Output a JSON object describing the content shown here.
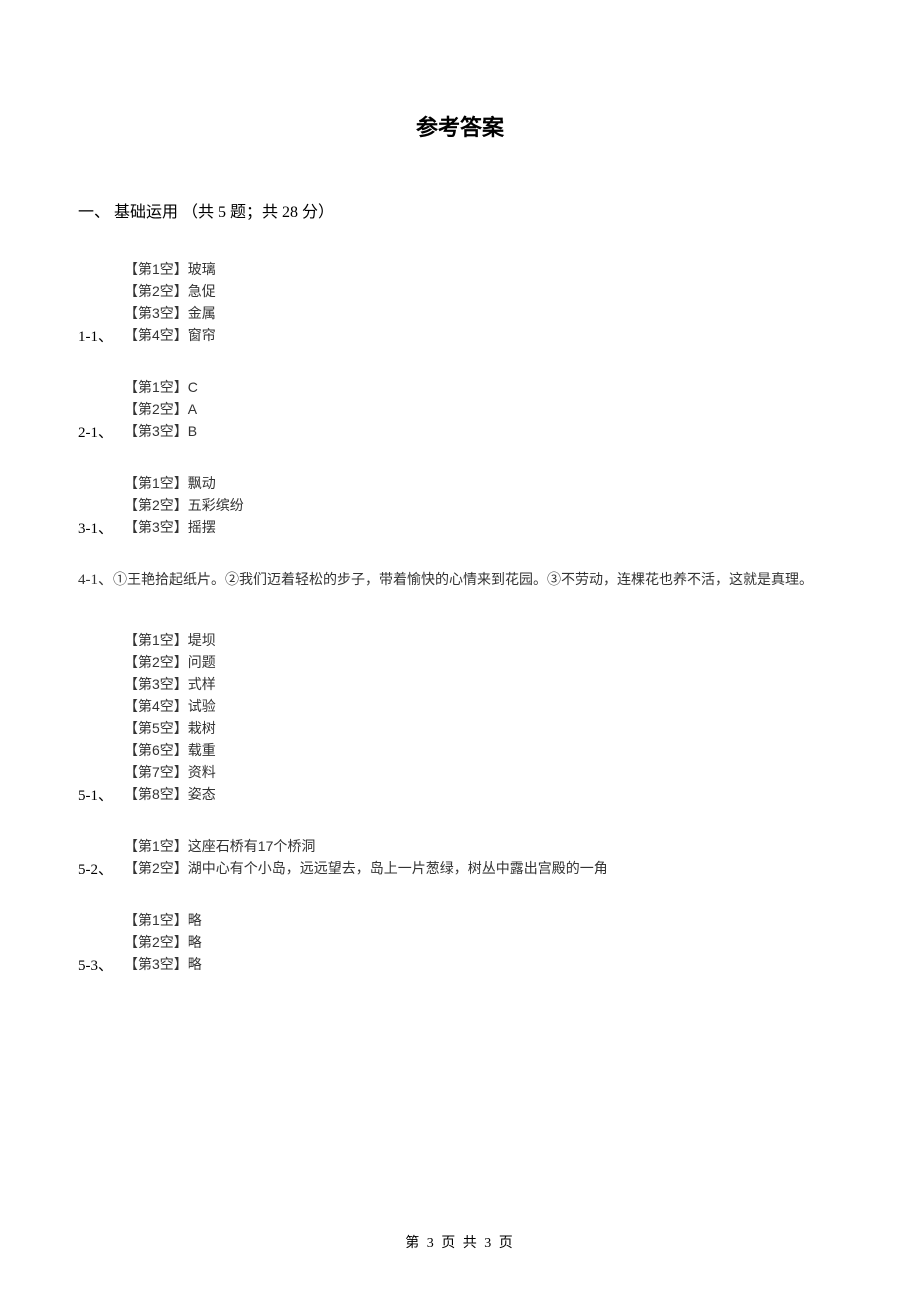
{
  "title": "参考答案",
  "section": "一、 基础运用 （共 5 题；共 28 分）",
  "q1": {
    "num": "1-1、",
    "lines": [
      "【第1空】玻璃",
      "【第2空】急促",
      "【第3空】金属",
      "【第4空】窗帘"
    ]
  },
  "q2": {
    "num": "2-1、",
    "lines": [
      "【第1空】C",
      "【第2空】A",
      "【第3空】B"
    ]
  },
  "q3": {
    "num": "3-1、",
    "lines": [
      "【第1空】飘动",
      "【第2空】五彩缤纷",
      "【第3空】摇摆"
    ]
  },
  "q4": {
    "num": "4-1、",
    "text": "①王艳拾起纸片。②我们迈着轻松的步子，带着愉快的心情来到花园。③不劳动，连棵花也养不活，这就是真理。"
  },
  "q5": {
    "num": "5-1、",
    "lines": [
      "【第1空】堤坝",
      "【第2空】问题",
      "【第3空】式样",
      "【第4空】试验",
      "【第5空】栽树",
      "【第6空】载重",
      "【第7空】资料",
      "【第8空】姿态"
    ]
  },
  "q6": {
    "num": "5-2、",
    "lines": [
      "【第1空】这座石桥有17个桥洞",
      "【第2空】湖中心有个小岛，远远望去，岛上一片葱绿，树丛中露出宫殿的一角"
    ]
  },
  "q7": {
    "num": "5-3、",
    "lines": [
      "【第1空】略",
      "【第2空】略",
      "【第3空】略"
    ]
  },
  "footer": "第 3 页 共 3 页"
}
